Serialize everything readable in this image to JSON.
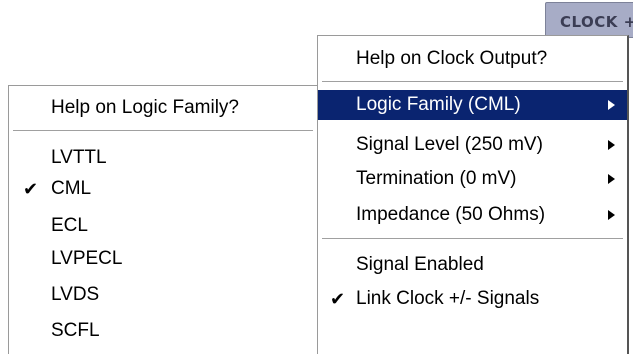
{
  "background_button": {
    "label": "CLOCK +"
  },
  "main_menu": {
    "help_label": "Help on Clock Output?",
    "items": [
      {
        "label": "Logic Family (CML)",
        "submenu": true,
        "highlighted": true
      },
      {
        "label": "Signal Level (250 mV)",
        "submenu": true
      },
      {
        "label": "Termination (0 mV)",
        "submenu": true
      },
      {
        "label": "Impedance (50 Ohms)",
        "submenu": true
      }
    ],
    "toggles": [
      {
        "label": "Signal Enabled",
        "checked": false
      },
      {
        "label": "Link Clock +/- Signals",
        "checked": true
      }
    ]
  },
  "logic_family_menu": {
    "help_label": "Help on Logic Family?",
    "options": [
      {
        "label": "LVTTL",
        "checked": false
      },
      {
        "label": "CML",
        "checked": true
      },
      {
        "label": "ECL",
        "checked": false
      },
      {
        "label": "LVPECL",
        "checked": false
      },
      {
        "label": "LVDS",
        "checked": false
      },
      {
        "label": "SCFL",
        "checked": false
      }
    ]
  },
  "icons": {
    "checkmark": "✔",
    "submenu_arrow": "arrow-right-icon"
  },
  "colors": {
    "highlight_background": "#0a2470",
    "highlight_text": "#ffffff",
    "button_background": "#a7acc6"
  }
}
